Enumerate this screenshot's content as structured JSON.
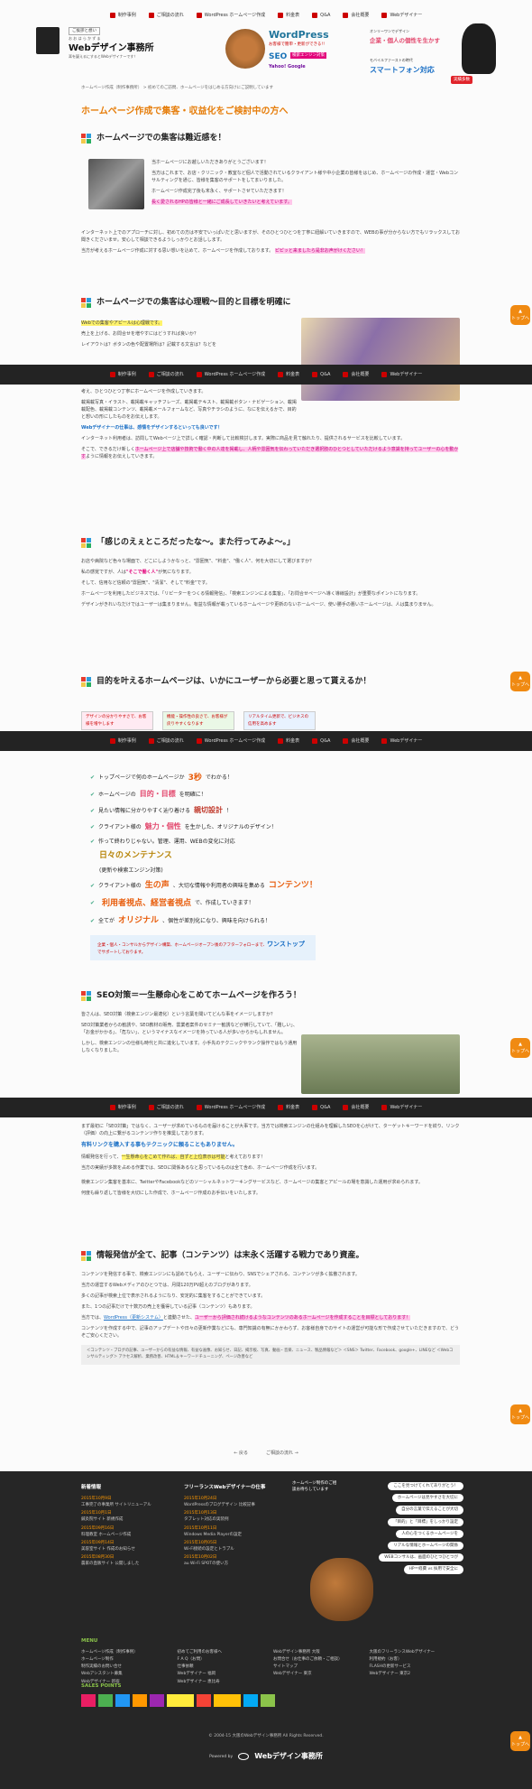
{
  "nav": [
    "制作事例",
    "ご相談の流れ",
    "WordPress ホームページ作成",
    "料金表",
    "Q&A",
    "会社概要",
    "Webデザイナー"
  ],
  "header": {
    "tagline": "ご挨拶と想い",
    "brand_ruby": "お お は ら か ず ま",
    "brand": "Webデザイン事務所",
    "brand_sub": "耳を疑えるにするとWebデザイナーです！",
    "wp_title": "WordPress",
    "wp_sub": "お客様で簡単・更新ができる!!",
    "seo": "SEO",
    "seo_sub": "検索エンジン対策",
    "engines": "Yahoo! Google",
    "promo1": "企業・個人の個性を生かす",
    "promo1_sub": "オンリーワンでデザイン",
    "promo2": "スマートフォン対応",
    "promo2_sub": "モバイルファーストの時代",
    "badge": "実績多数"
  },
  "breadcrumb": "ホームページ作成（制作事務所） > 初めてのご訪問、ホームページをはじめる方向けにご説明しています",
  "page_title": "ホームページ作成で集客・収益化をご検討中の方へ",
  "sec1": {
    "title": "ホームページでの集客は難近感を！",
    "p1": "当ホームページにお越しいただきありがとうございます！",
    "p2": "当方はこれまで、お店・クリニック・教室など個人で活動されているクライアント様や中小企業の皆様をはじめ、ホームページの作成・運営・Webコンサルティングを通じ、皆様を集客のサポートをしてまいりました。",
    "p3": "ホームページ作成完了後も末永く、サポートさせていただきます！",
    "p3b": "長く愛されるHPの皆様と一緒にご成長していきたいと考えています。",
    "p4": "インターネット上でのアプローチに対し、初めての方は不安でいっぱいだと思いますが、そのひとつひとつを丁寧に紐解いていきますので、WEBの事が分からない方でもリラックスしてお聞きくださいませ。安心して相談できるようしっかりとお話しします。",
    "p5": "当方が考えるホームページ作成に対する思い想いを込めて、ホームページを作成しております。",
    "p5hl": "ピピッと来ましたら是非お声がけください！"
  },
  "sec2": {
    "title": "ホームページでの集客は心理戦〜目的と目標を明確に",
    "hl1": "Webでの集客やアピールは心理戦です。",
    "p1": "売上を上げる、お問合せを増やすにはどうすれば良いか？",
    "p2": "レイアウトは？ボタンの色や配置場所は？記載する文言は？などを",
    "p3": "考え、ひとつひとつ丁寧にホームページを作成していきます。",
    "p4": "載掲載写真・イラスト、載掲載キャッチフレーズ、載掲載テキスト、載掲載ボタン・ナビゲーション、載掲載配色、載掲載コンテンツ、載掲載メールフォームなど、写真やチラシのように、なにを伝えるかで、目的と想いの形にしたものをお伝えします。",
    "blue": "Webデザイナーの仕事は、感情をデザインするといっても良いです！",
    "p5": "インターネット利用者は、訪問してWebページ上で詳しく確認・判断して比較検討します。実際に商品を見て触れたり、提供されるサービスを比較しています。",
    "p6": "そこで、できるだけ新しく",
    "p6hl": "ホームページ上で店舗や技術で働く中の人達を掲載し、人柄や雰囲気を伝わっていただき選択肢のひとつとしていただけるよう意識を持って",
    "p6b": "ユーザーの心を動かす",
    "p6c": "ように情報をお伝えしていきます。"
  },
  "sec3": {
    "title": "「感じのえぇところだったな〜。また行ってみよ〜。」",
    "p1": "お店や病院など色々な場面で、どこにしようかなっと、\"雰囲気\"、\"料金\"、\"働く人\"、何を大切にして選びますか？",
    "p2": "私の感覚ですが、人は",
    "p2hl": "\"そこで働く人\"",
    "p2b": "が気になります。",
    "p3": "そして、信用など信頼の\"雰囲気\"、\"清潔\"、そして\"料金\"です。",
    "p4": "ホームページを利用したビジネスでは、「リピーターをつくる情報発信」、「検索エンジンによる集客」、「お問合せページへ導く導線設計」が重要なポイントになります。",
    "p5": "デザインがきれいなだけではユーザーは集まりません。有益な情報が載っているホームページや更新のないホームページ、使い勝手の悪いホームページは、人は集まりません。"
  },
  "sec4": {
    "title": "目的を叶えるホームページは、いかにユーザーから必要と思って貰えるか！",
    "tab1": "デザインの分かりやすさで、お客様を増やします",
    "tab2": "機能・操作性の良さで、お客様が戻りやすくなります",
    "tab3": "リアルタイム更新で、ビジネスの信用を高めます",
    "checks": [
      {
        "a": "トップページで何のホームページか",
        "b": "3秒",
        "c": "でわかる！"
      },
      {
        "a": "ホームページの",
        "b": "目的・目標",
        "c": "を明確に！"
      },
      {
        "a": "見たい情報に分かりやすく辿り着ける",
        "b": "親切設計",
        "c": "！"
      },
      {
        "a": "クライアント様の",
        "b": "魅力・個性",
        "c": "を生かした、オリジナルのデザイン！"
      },
      {
        "a": "作って終わりじゃない。管理、運用、WEBの変化に対応",
        "b": "日々のメンテナンス",
        "c": "(更新や検索エンジン対策)"
      },
      {
        "a": "クライアント様の",
        "b": "生の声",
        "c": "、大切な情報や利用者の興味を集める",
        "d": "コンテンツ！"
      },
      {
        "a": "",
        "b": "利用者視点、経営者視点",
        "c": "で、作成していきます！"
      },
      {
        "a": "全てが",
        "b": "オリジナル",
        "c": "、個性が差別化になり、興味を向けられる！"
      }
    ],
    "note1": "企業・個人・コンサルからデザイン構築、ホームページオープン後のアフターフォローまで、",
    "note2": "ワンストップ",
    "note3": "でサポートしております。"
  },
  "sec5": {
    "title": "SEO対策＝一生懸命心をこめてホームページを作ろう！",
    "p1": "皆さんは、SEO対策（検索エンジン最適化）という言葉を聞いてどんな事をイメージしますか？",
    "p2": "SEO対策業者からの勧誘や、SEO教材の販売、雲業者案件のセミナー勧誘などが横行していて、「難しい」、「お金がかかる」、「危ない」、というマイナスなイメージを持っている人が多いからかもしれません。",
    "p3": "しかし、検索エンジンの仕様も時代と共に進化しています。小手先のテクニックやランク操作ではもう通用しなくなりました。",
    "p4": "まず最初に「SEO対策」ではなく、ユーザーが求めているものを届けることが大事です。当方では検索エンジンの仕組みを理解したSEOを心がけて、ターゲットキーワードを絞り、リンク（評価）の向上に繋がるコンテンツ作りを推奨しております。",
    "blue": "有料リンクを購入する事もテクニックに頼ることもありません。",
    "p5": "情報発信を行って、",
    "p5hl": "一生懸命心をこめて作れば、自ずと上位表示は可能",
    "p5b": "と考えております！",
    "p6": "当方の実績が多数を占める作業では、SEOに関係あるなと思っているものは全て含め、ホームページ作成を行います。",
    "p7": "検索エンジン集客を基本に、TwitterやFacebookなどのソーシャルネットワーキングサービスなど、ホームページの集客とアピールの場を意識した運用が求められます。",
    "p8": "何度も繰り返して皆様を大切にした作成で、ホームページ作成のお手伝いをいたします。"
  },
  "sec6": {
    "title": "情報発信が全て、記事（コンテンツ）は末永く活躍する戦力であり資産。",
    "p1": "コンテンツを発信する事で、検索エンジンにも認めてもらえ、ユーザーに伝わり、SNSでシェアされる、コンテンツが多く拡散されます。",
    "p2": "当方の運営するWebメディアのひとつでは、月間120万PV超えのブログがあります。",
    "p3": "多くの記事が検索上位で表示されるようになり、安定的に集客をすることができています。",
    "p4": "また、1つの記事だけで十数万の売上を獲得している記事（コンテンツ）もあります。",
    "p5": "当方では、",
    "p5a": "WordPress（更新システム）",
    "p5b": "と連動させた、",
    "p5hl": "ユーザーから評価され続けるようなコンテンツのあるホームページを作成することを目標としております！",
    "p6": "コンテンツを作成する中で、記事のアップデートや日々の更新作業などにも、専門知識の有無にかかわらず、お客様自身でのサイトの運営が可能な形で作成させていただきますので、どうぞご安心ください。",
    "tags": "＜コンテンツ・ブログの記事、ユーザーからの有益な情報、有益な画像、お知らせ、日記、掲示板、写真、動画・音楽、ニュース、製品情報など＞ ＜SNS＞ Twitter、Facebook、google+、LINEなど ＜Webコンサルティング＞ アクセス解析、業務改善、HTML＆キーワードチューニング、ページ改善など"
  },
  "pager": {
    "prev": "← 戻る",
    "next": "ご相談の流れ →"
  },
  "top_button": "トップへ",
  "footer": {
    "col1_title": "新着情報",
    "news": [
      {
        "date": "2015年10月9日",
        "text": "工事完了の事業所 サイトリニューアル"
      },
      {
        "date": "2015年10月1日",
        "text": "鍼灸院サイト 新規作成"
      },
      {
        "date": "2015年09月16日",
        "text": "料理教室 ホームページ作成"
      },
      {
        "date": "2015年09月14日",
        "text": "美容室サイト 作成のお知らせ"
      },
      {
        "date": "2015年08月30日",
        "text": "農家の直販サイト 公開しました"
      }
    ],
    "col2_title": "フリーランスWebデザイナーの仕事",
    "posts": [
      {
        "date": "2015年10月24日",
        "text": "WordPressのブログデザイン 比較記事"
      },
      {
        "date": "2015年10月13日",
        "text": "タブレット対応の実装例"
      },
      {
        "date": "2015年10月11日",
        "text": "Windows Media Playerの設定"
      },
      {
        "date": "2015年10月05日",
        "text": "Wi-Fi接続の設定とトラブル"
      },
      {
        "date": "2015年10月02日",
        "text": "au Wi-Fi SPOTの使い方"
      }
    ],
    "callout": "ホームページ制作のご相談お待ちしています",
    "bubbles": [
      "ここを見つけてくれてありがとう！",
      "ホームページは見やすさを大切に",
      "自分の言葉で伝えることが大切",
      "「目的」と「目標」をしっかり設定",
      "人の心をつくるホームページを",
      "リアルな情報とホームページの関係",
      "WEBコンサルは、画面のひとつひとつが",
      "HP＝経費 vs 採用で安全に"
    ],
    "menu_title": "MENU",
    "menu": [
      "ホームページ作成（制作事例）",
      "初めてご利用のお客様へ",
      "Webデザイン事務所 大阪",
      "大阪のフリーランスWebデザイナー",
      "ホームページ制作",
      "F A Q（お問）",
      "お問合せ（お仕事のご依頼・ご相談）",
      "利用規約（お客）",
      "制作実績のお問い合せ",
      "仕事依頼",
      "サイトマップ",
      "FLASHの更新サービス",
      "Webアシスタント募集",
      "Webデザイナー 福岡",
      "Webデザイナー 東京",
      "Webデザイナー 東京2",
      "Webデザイナー 新宿",
      "Webデザイナー 恵比寿"
    ],
    "sales_title": "SALES POINTS",
    "copyright": "© 2004-15 大阪のWebデザイン事務所 All Rights Reserved.",
    "powered": "Powered by",
    "powered_brand": "Webデザイン事務所"
  }
}
